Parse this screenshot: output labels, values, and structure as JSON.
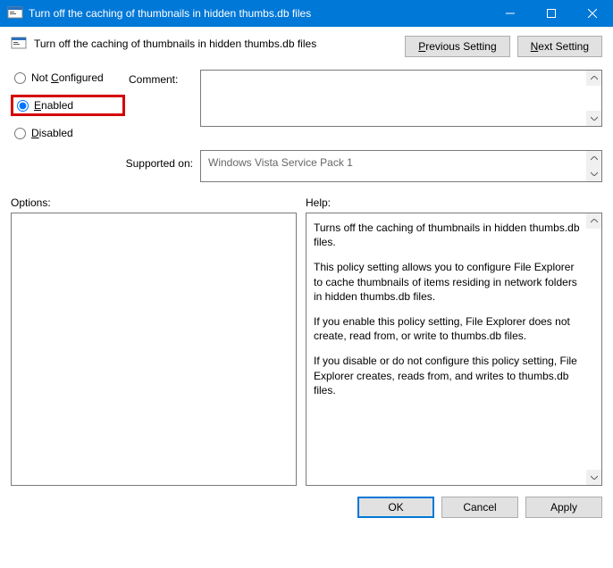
{
  "window": {
    "title": "Turn off the caching of thumbnails in hidden thumbs.db files"
  },
  "header": {
    "policy_title": "Turn off the caching of thumbnails in hidden thumbs.db files",
    "prev_setting": "Previous Setting",
    "next_setting": "Next Setting"
  },
  "state": {
    "not_configured": "Not Configured",
    "enabled": "Enabled",
    "disabled": "Disabled",
    "selected": "enabled"
  },
  "labels": {
    "comment": "Comment:",
    "supported_on": "Supported on:",
    "options": "Options:",
    "help": "Help:"
  },
  "supported_on": "Windows Vista Service Pack 1",
  "help": {
    "p1": "Turns off the caching of thumbnails in hidden thumbs.db files.",
    "p2": "This policy setting allows you to configure File Explorer to cache thumbnails of items residing in network folders in hidden thumbs.db files.",
    "p3": "If you enable this policy setting, File Explorer does not create, read from, or write to thumbs.db files.",
    "p4": "If you disable or do not configure this policy setting, File Explorer creates, reads from, and writes to thumbs.db files."
  },
  "footer": {
    "ok": "OK",
    "cancel": "Cancel",
    "apply": "Apply"
  }
}
